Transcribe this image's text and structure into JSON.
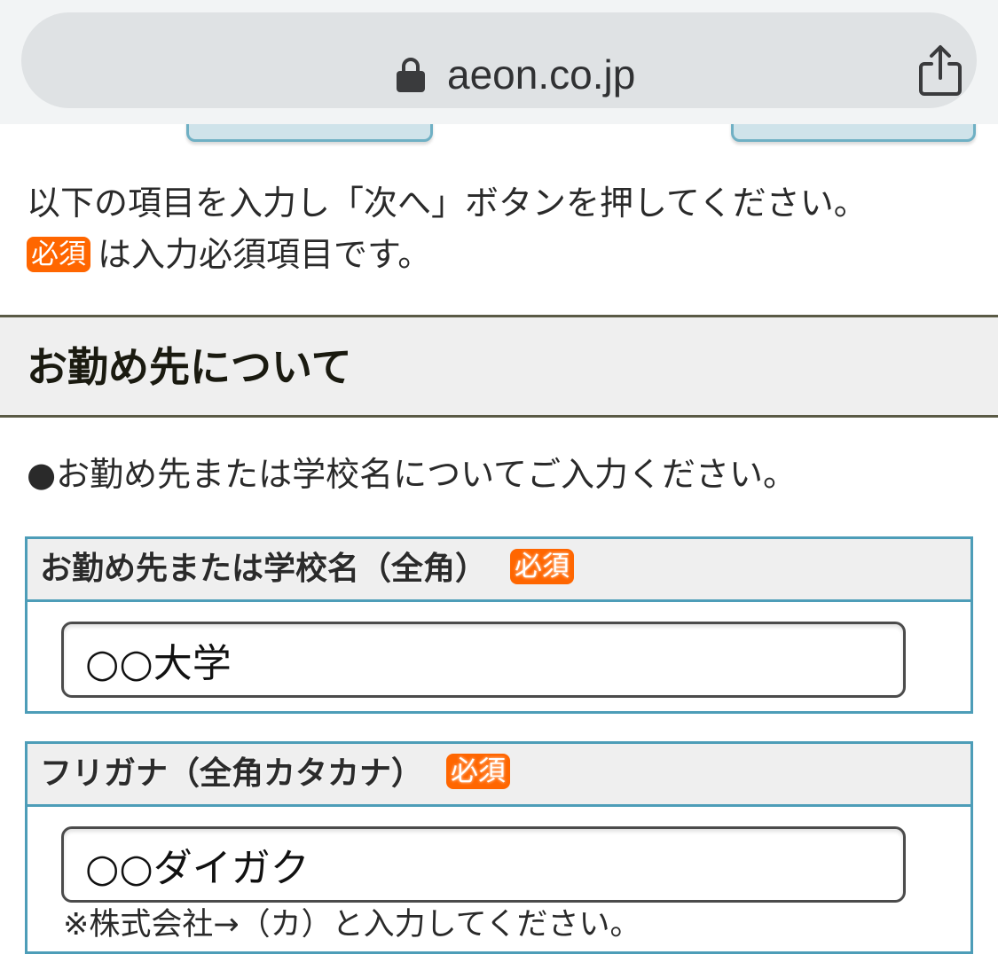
{
  "browser": {
    "url": "aeon.co.jp",
    "lock_icon": "lock-icon",
    "share_icon": "share-icon"
  },
  "intro": {
    "line1": "以下の項目を入力し「次へ」ボタンを押してください。",
    "badge": "必須",
    "line2": "は入力必須項目です。"
  },
  "section": {
    "title": "お勤め先について"
  },
  "notice": "●お勤め先または学校名についてご入力ください。",
  "fields": {
    "company": {
      "label": "お勤め先または学校名（全角）",
      "badge": "必須",
      "value": "○○大学"
    },
    "furigana": {
      "label": "フリガナ（全角カタカナ）",
      "badge": "必須",
      "value": "○○ダイガク",
      "hint": "※株式会社→（カ）と入力してください。"
    }
  },
  "colors": {
    "badge": "#ff6600",
    "field_border": "#4d9db8",
    "section_border": "#5a5a45"
  }
}
